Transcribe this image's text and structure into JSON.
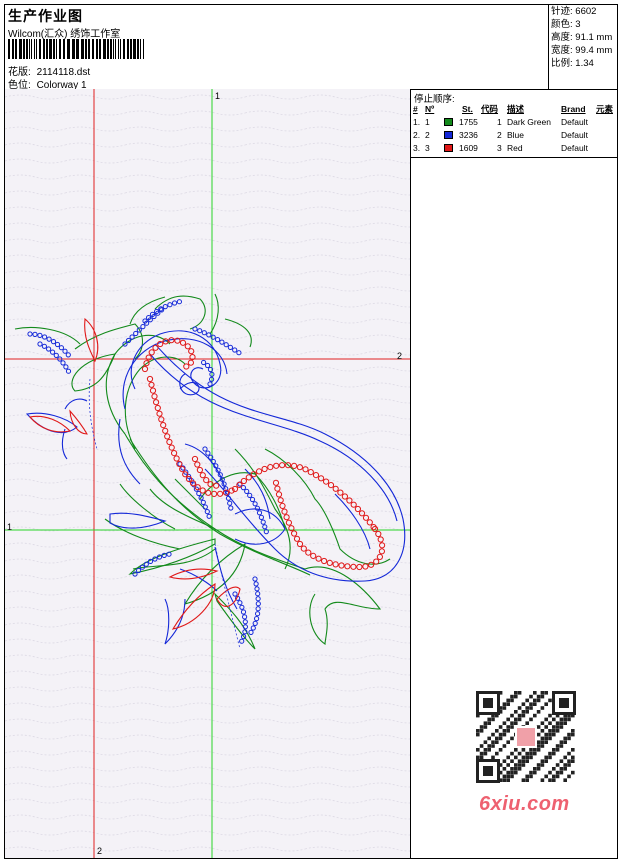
{
  "header": {
    "title": "生产作业图",
    "studio": "Wilcom(汇众) 绣饰工作室",
    "design_label": "花版:",
    "design_value": "2114118.dst",
    "colorway_label": "色位:",
    "colorway_value": "Colorway 1"
  },
  "stats": {
    "stitches_label": "针迹:",
    "stitches_value": "6602",
    "colors_label": "颜色:",
    "colors_value": "3",
    "height_label": "高度:",
    "height_value": "91.1 mm",
    "width_label": "宽度:",
    "width_value": "99.4 mm",
    "ratio_label": "比例:",
    "ratio_value": "1.34"
  },
  "stop_sequence": {
    "title": "停止顺序:",
    "columns": [
      "#",
      "Nº",
      "St.",
      "代码",
      "描述",
      "Brand",
      "元素"
    ],
    "rows": [
      {
        "index": "1.",
        "no": "1",
        "stitches": "1755",
        "code": "1",
        "description": "Dark Green",
        "brand": "Default",
        "color": "#138a1b"
      },
      {
        "index": "2.",
        "no": "2",
        "stitches": "3236",
        "code": "2",
        "description": "Blue",
        "brand": "Default",
        "color": "#1428d8"
      },
      {
        "index": "3.",
        "no": "3",
        "stitches": "1609",
        "code": "3",
        "description": "Red",
        "brand": "Default",
        "color": "#e01818"
      }
    ]
  },
  "guides": {
    "green_label": "1",
    "red_label": "2"
  },
  "watermark": {
    "text": "6xiu.com"
  },
  "colors": {
    "green": "#138a1b",
    "blue": "#1428d8",
    "red": "#e01818",
    "guide_green": "#27d427",
    "guide_red": "#e02020",
    "watermark": "#ee6170"
  }
}
